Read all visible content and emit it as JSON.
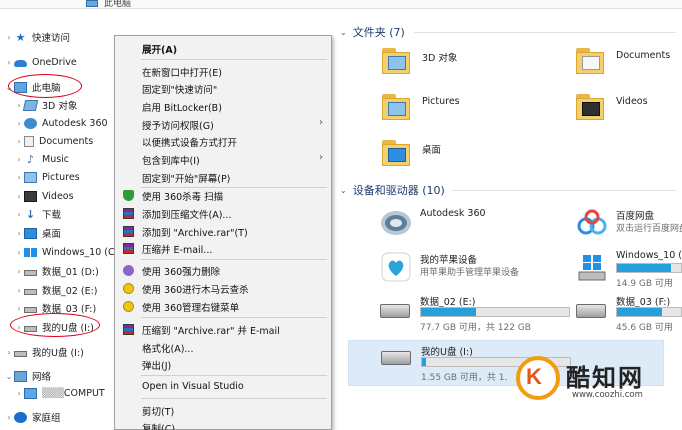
{
  "window": {
    "title": "此电脑"
  },
  "nav": {
    "items": [
      {
        "label": "快速访问",
        "icon": "star-icon"
      },
      {
        "label": "OneDrive",
        "icon": "cloud-icon"
      },
      {
        "label": "此电脑",
        "icon": "computer-icon"
      },
      {
        "label": "3D 对象",
        "icon": "cube-icon"
      },
      {
        "label": "Autodesk 360",
        "icon": "autodesk-icon"
      },
      {
        "label": "Documents",
        "icon": "document-icon"
      },
      {
        "label": "Music",
        "icon": "music-icon"
      },
      {
        "label": "Pictures",
        "icon": "picture-icon"
      },
      {
        "label": "Videos",
        "icon": "video-icon"
      },
      {
        "label": "下载",
        "icon": "download-icon"
      },
      {
        "label": "桌面",
        "icon": "desktop-icon"
      },
      {
        "label": "Windows_10 (C:)",
        "icon": "windows-drive-icon"
      },
      {
        "label": "数据_01 (D:)",
        "icon": "drive-icon"
      },
      {
        "label": "数据_02 (E:)",
        "icon": "drive-icon"
      },
      {
        "label": "数据_03 (F:)",
        "icon": "drive-icon"
      },
      {
        "label": "我的U盘 (I:)",
        "icon": "usb-drive-icon"
      },
      {
        "label": "我的U盘 (I:)",
        "icon": "usb-drive-icon"
      },
      {
        "label": "网络",
        "icon": "network-icon"
      },
      {
        "label": "COMPUT",
        "icon": "computer-icon"
      },
      {
        "label": "家庭组",
        "icon": "homegroup-icon"
      }
    ]
  },
  "context_menu": {
    "items": [
      {
        "label": "展开(A)"
      },
      {
        "label": "在新窗口中打开(E)"
      },
      {
        "label": "固定到\"快速访问\""
      },
      {
        "label": "启用 BitLocker(B)"
      },
      {
        "label": "授予访问权限(G)"
      },
      {
        "label": "以便携式设备方式打开"
      },
      {
        "label": "包含到库中(I)"
      },
      {
        "label": "固定到\"开始\"屏幕(P)"
      },
      {
        "label": "使用 360杀毒 扫描"
      },
      {
        "label": "添加到压缩文件(A)..."
      },
      {
        "label": "添加到 \"Archive.rar\"(T)"
      },
      {
        "label": "压缩并 E-mail..."
      },
      {
        "label": "使用 360强力删除"
      },
      {
        "label": "使用 360进行木马云查杀"
      },
      {
        "label": "使用 360管理右键菜单"
      },
      {
        "label": "压缩到 \"Archive.rar\" 并 E-mail"
      },
      {
        "label": "格式化(A)..."
      },
      {
        "label": "弹出(J)"
      },
      {
        "label": "Open in Visual Studio"
      },
      {
        "label": "剪切(T)"
      },
      {
        "label": "复制(C)"
      }
    ]
  },
  "content": {
    "folders_header": "文件夹 (7)",
    "folders": [
      {
        "label": "3D 对象"
      },
      {
        "label": "Documents"
      },
      {
        "label": "Pictures"
      },
      {
        "label": "Videos"
      },
      {
        "label": "桌面"
      }
    ],
    "devices_header": "设备和驱动器 (10)",
    "apps": [
      {
        "name": "Autodesk 360"
      },
      {
        "name": "百度网盘",
        "sub": "双击运行百度网盘"
      },
      {
        "name": "我的苹果设备",
        "sub": "用苹果助手管理苹果设备"
      }
    ],
    "drives": [
      {
        "name": "Windows_10 (C:)",
        "size": "14.9 GB 可用",
        "fill": 0.85
      },
      {
        "name": "数据_02 (E:)",
        "size": "77.7 GB 可用，共 122 GB",
        "fill": 0.37
      },
      {
        "name": "数据_03 (F:)",
        "size": "45.6 GB 可用",
        "fill": 0.7
      },
      {
        "name": "我的U盘 (I:)",
        "size": "1.55 GB 可用，共 1.",
        "fill": 0.03
      }
    ]
  },
  "watermark": {
    "name": "酷知网",
    "url": "www.coozhi.com"
  },
  "colors": {
    "accent": "#26a0da",
    "annotation": "#d9001b",
    "header": "#1e3a6e"
  }
}
